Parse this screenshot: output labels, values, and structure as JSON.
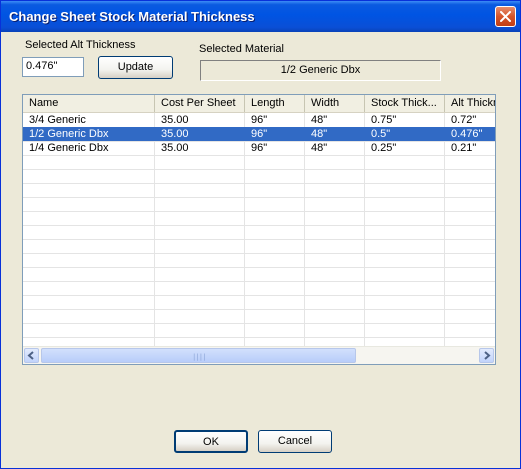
{
  "window": {
    "title": "Change Sheet Stock Material Thickness"
  },
  "alt_thickness": {
    "label": "Selected Alt Thickness",
    "value": "0.476\""
  },
  "update_label": "Update",
  "selected_material": {
    "label": "Selected Material",
    "value": "1/2 Generic Dbx"
  },
  "grid": {
    "columns": [
      "Name",
      "Cost Per Sheet",
      "Length",
      "Width",
      "Stock Thick...",
      "Alt Thickn"
    ],
    "rows": [
      [
        "3/4 Generic",
        "35.00",
        "96\"",
        "48\"",
        "0.75\"",
        "0.72\""
      ],
      [
        "1/2 Generic Dbx",
        "35.00",
        "96\"",
        "48\"",
        "0.5\"",
        "0.476\""
      ],
      [
        "1/4 Generic Dbx",
        "35.00",
        "96\"",
        "48\"",
        "0.25\"",
        "0.21\""
      ]
    ],
    "selected_row": 1
  },
  "buttons": {
    "ok": "OK",
    "cancel": "Cancel"
  },
  "colors": {
    "title_bar": "#0054e3",
    "selection": "#316ac5",
    "dialog_bg": "#ece9d8"
  }
}
